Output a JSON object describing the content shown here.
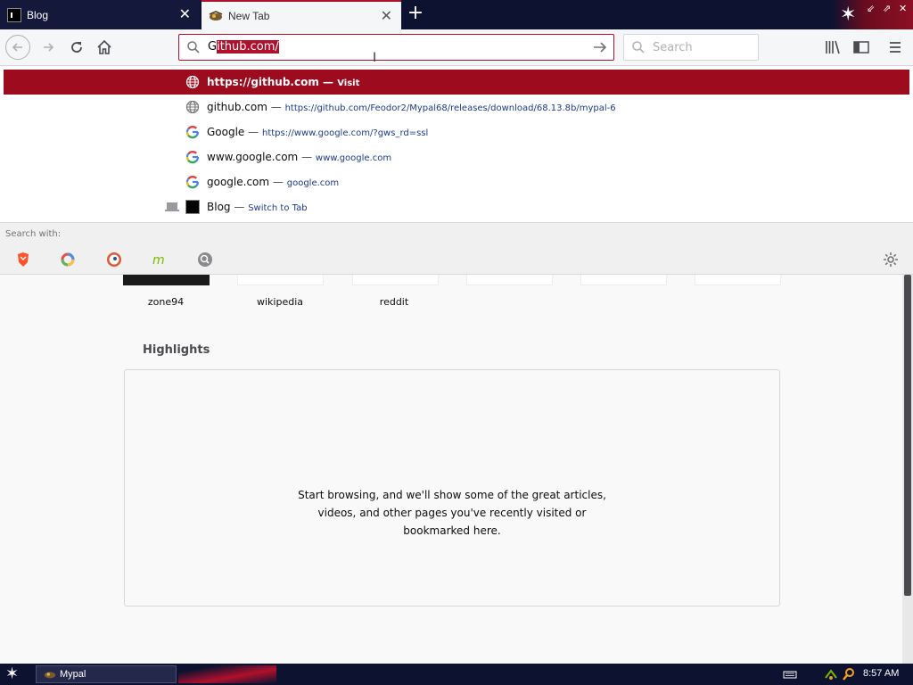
{
  "tabs": [
    {
      "title": "Blog",
      "active": false
    },
    {
      "title": "New Tab",
      "active": true
    }
  ],
  "window_controls": [
    "⇙",
    "⇗",
    "✕"
  ],
  "urlbar": {
    "typed": "G",
    "autocompleted": "ithub.com/"
  },
  "searchbar": {
    "placeholder": "Search"
  },
  "dropdown": {
    "selected": {
      "title": "https://github.com",
      "sep": "—",
      "action": "Visit"
    },
    "rows": [
      {
        "icon": "globe-icon",
        "title": "github.com",
        "url": "https://github.com/Feodor2/Mypal68/releases/download/68.13.8b/mypal-6"
      },
      {
        "icon": "google-icon",
        "title": "Google",
        "url": "https://www.google.com/?gws_rd=ssl"
      },
      {
        "icon": "google-icon",
        "title": "www.google.com",
        "url": "www.google.com"
      },
      {
        "icon": "google-icon",
        "title": "google.com",
        "url": "google.com"
      },
      {
        "icon": "tab-icon",
        "title": "Blog",
        "url": "Switch to Tab"
      }
    ],
    "sep": "—"
  },
  "search_with": {
    "label": "Search with:",
    "engines": [
      "brave-icon",
      "qwant-icon",
      "duckduckgo-icon",
      "mojeek-icon",
      "searx-icon"
    ]
  },
  "topsites": [
    "zone94",
    "wikipedia",
    "reddit",
    "",
    "",
    ""
  ],
  "highlights": {
    "title": "Highlights",
    "message_line1": "Start browsing, and we'll show some of the great articles,",
    "message_line2": "videos, and other pages you've recently visited or",
    "message_line3": "bookmarked here."
  },
  "taskbar": {
    "app": "Mypal",
    "clock": "8:57 AM"
  },
  "colors": {
    "accent": "#b0102c",
    "selected_row": "#9d0c1e",
    "tabstrip": "#0e1231"
  }
}
